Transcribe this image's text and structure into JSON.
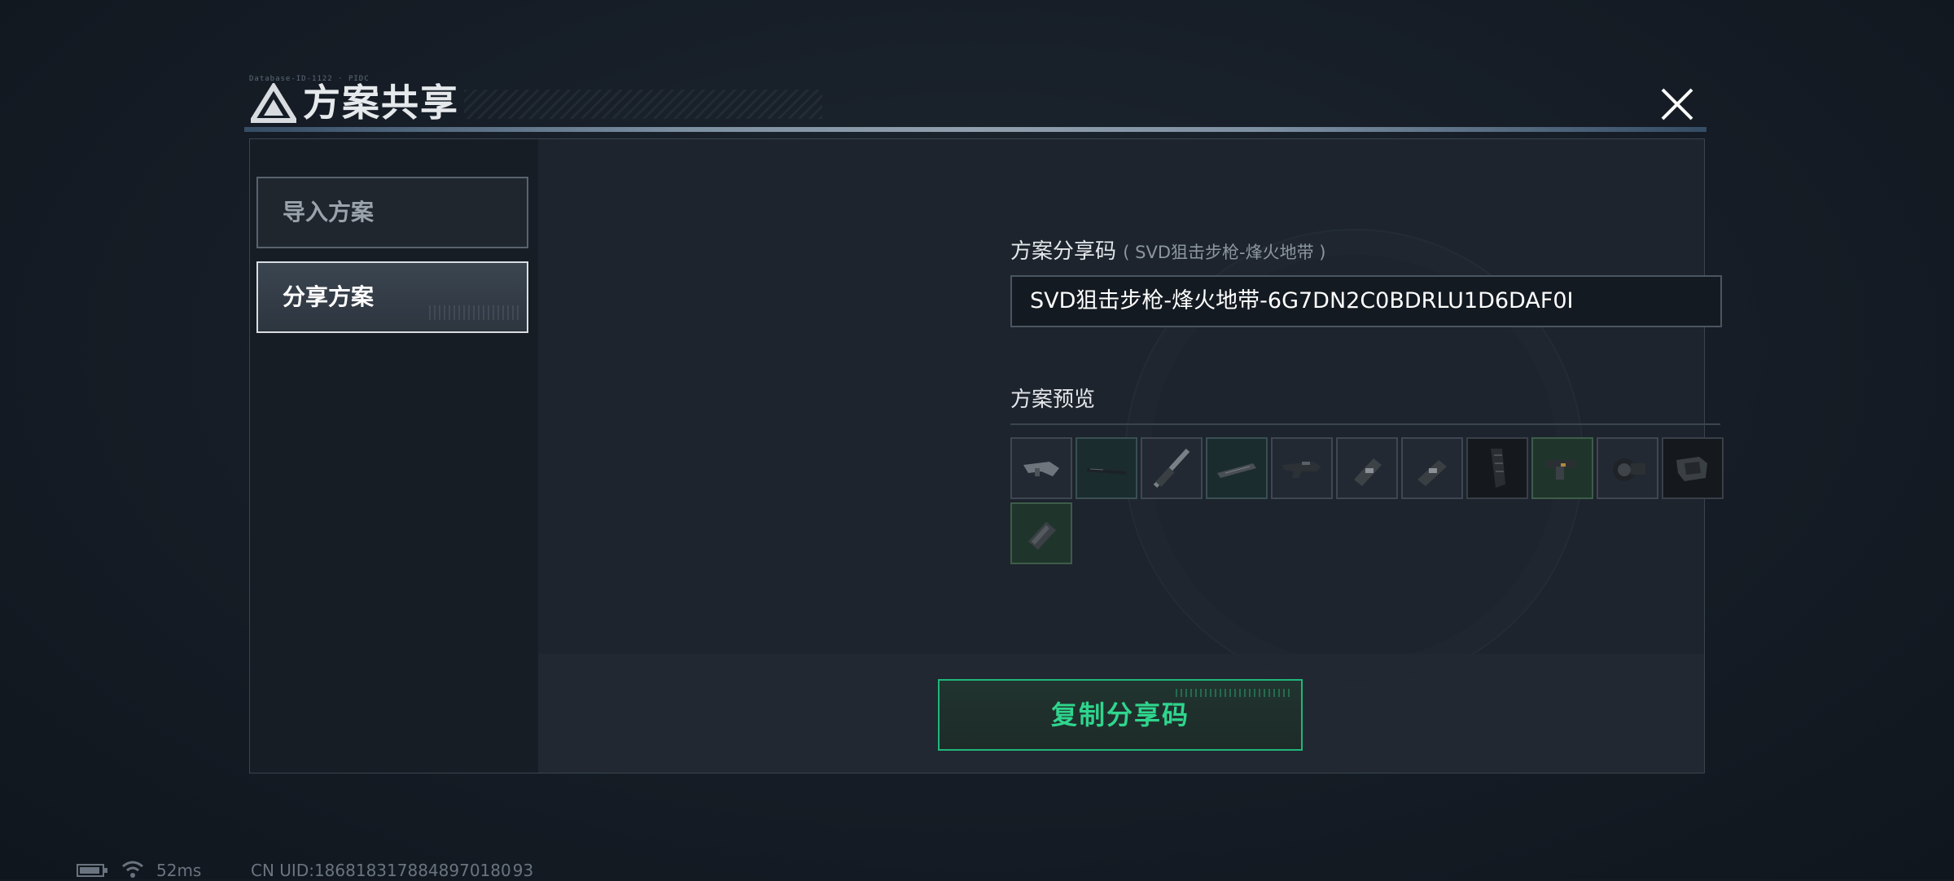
{
  "header": {
    "title": "方案共享",
    "tiny_text": "Database-ID-1122 · PIDC"
  },
  "sidebar": {
    "items": [
      {
        "label": "导入方案",
        "active": false
      },
      {
        "label": "分享方案",
        "active": true
      }
    ]
  },
  "main": {
    "code_label": "方案分享码",
    "code_label_sub": "( SVD狙击步枪-烽火地带 )",
    "code_value": "SVD狙击步枪-烽火地带-6G7DN2C0BDRLU1D6DAF0I",
    "preview_label": "方案预览",
    "items": [
      {
        "icon": "stock-icon",
        "tone": "normal"
      },
      {
        "icon": "rail-icon",
        "tone": "teal"
      },
      {
        "icon": "barrel-icon",
        "tone": "normal"
      },
      {
        "icon": "handguard-icon",
        "tone": "teal"
      },
      {
        "icon": "receiver-icon",
        "tone": "normal"
      },
      {
        "icon": "mount-icon",
        "tone": "normal"
      },
      {
        "icon": "mount-icon",
        "tone": "normal"
      },
      {
        "icon": "magazine-icon",
        "tone": "dark"
      },
      {
        "icon": "grip-icon",
        "tone": "green"
      },
      {
        "icon": "scope-icon",
        "tone": "normal"
      },
      {
        "icon": "buttstock-icon",
        "tone": "dark"
      },
      {
        "icon": "muzzle-icon",
        "tone": "green"
      }
    ],
    "copy_button": "复制分享码"
  },
  "status_bar": {
    "ping": "52ms",
    "uid": "CN UID:1868183178848970180 93"
  },
  "colors": {
    "accent_green": "#2fd58d",
    "panel": "#1d242d"
  }
}
